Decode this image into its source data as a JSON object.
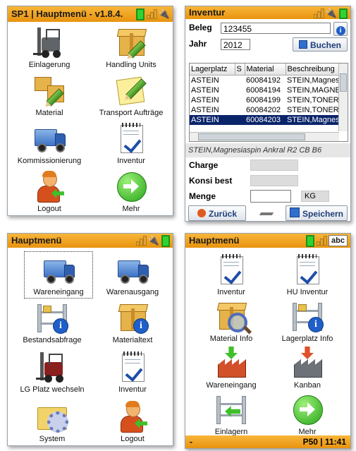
{
  "panel1": {
    "title": "SP1 | Hauptmenü - v1.8.4.",
    "items": [
      {
        "label": "Einlagerung",
        "icon": "forklift-icon"
      },
      {
        "label": "Handling Units",
        "icon": "box-pencil-icon"
      },
      {
        "label": "Material",
        "icon": "boxes-pencil-icon"
      },
      {
        "label": "Transport Aufträge",
        "icon": "notepad-pencil-icon"
      },
      {
        "label": "Kommissionierung",
        "icon": "truck-icon"
      },
      {
        "label": "Inventur",
        "icon": "clipboard-check-icon"
      },
      {
        "label": "Logout",
        "icon": "user-logout-icon"
      },
      {
        "label": "Mehr",
        "icon": "arrow-right-circle-icon"
      }
    ]
  },
  "panel2": {
    "title": "Inventur",
    "beleg_label": "Beleg",
    "beleg_value": "123455",
    "jahr_label": "Jahr",
    "jahr_value": "2012",
    "buchen_label": "Buchen",
    "columns": [
      "Lagerplatz",
      "S",
      "Material",
      "Beschreibung"
    ],
    "rows": [
      [
        "ASTEIN",
        "",
        "60084192",
        "STEIN,Magnesi"
      ],
      [
        "ASTEIN",
        "",
        "60084194",
        "STEIN,MAGNES"
      ],
      [
        "ASTEIN",
        "",
        "60084199",
        "STEIN,TONERDE"
      ],
      [
        "ASTEIN",
        "",
        "60084202",
        "STEIN,TONERDE"
      ],
      [
        "ASTEIN",
        "",
        "60084203",
        "STEIN,Magnesi"
      ]
    ],
    "selected_row": 4,
    "description": "STEIN,Magnesiaspin Ankral R2 CB B6",
    "charge_label": "Charge",
    "konsi_label": "Konsi best",
    "menge_label": "Menge",
    "menge_unit": "KG",
    "zurueck_label": "Zurück",
    "speichern_label": "Speichern"
  },
  "panel3": {
    "title": "Hauptmenü",
    "items": [
      {
        "label": "Wareneingang",
        "icon": "truck-icon"
      },
      {
        "label": "Warenausgang",
        "icon": "truck-icon"
      },
      {
        "label": "Bestandsabfrage",
        "icon": "rack-info-icon"
      },
      {
        "label": "Materialtext",
        "icon": "box-info-icon"
      },
      {
        "label": "LG Platz wechseln",
        "icon": "forklift-icon"
      },
      {
        "label": "Inventur",
        "icon": "clipboard-check-icon"
      },
      {
        "label": "System",
        "icon": "folder-gear-icon"
      },
      {
        "label": "Logout",
        "icon": "user-logout-icon"
      }
    ]
  },
  "panel4": {
    "title": "Hauptmenü",
    "abc": "abc",
    "items": [
      {
        "label": "Inventur",
        "icon": "clipboard-check-icon"
      },
      {
        "label": "HU Inventur",
        "icon": "clipboard-check-icon"
      },
      {
        "label": "Material Info",
        "icon": "box-magnifier-icon"
      },
      {
        "label": "Lagerplatz Info",
        "icon": "rack-info-icon"
      },
      {
        "label": "Wareneingang",
        "icon": "factory-in-icon"
      },
      {
        "label": "Kanban",
        "icon": "factory-kanban-icon"
      },
      {
        "label": "Einlagern",
        "icon": "rack-arrow-icon"
      },
      {
        "label": "Mehr",
        "icon": "arrow-right-circle-icon"
      }
    ],
    "status_left": "-",
    "status_right": "P50 | 11:41"
  },
  "colors": {
    "titlebar": "#f0a020",
    "selection": "#0a246a",
    "accent": "#1e3f7a"
  }
}
